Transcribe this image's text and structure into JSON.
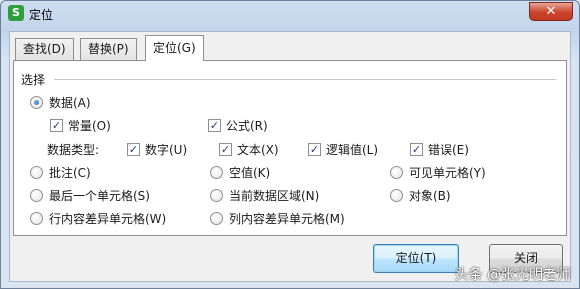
{
  "window": {
    "app_icon": "S",
    "title": "定位",
    "close_glyph": "✕"
  },
  "tabs": [
    {
      "label": "查找(D)"
    },
    {
      "label": "替换(P)"
    },
    {
      "label": "定位(G)"
    }
  ],
  "group": {
    "label": "选择"
  },
  "options": {
    "data": "数据(A)",
    "constants": "常量(O)",
    "formulas": "公式(R)",
    "data_type_label": "数据类型:",
    "number": "数字(U)",
    "text": "文本(X)",
    "logical": "逻辑值(L)",
    "error": "错误(E)",
    "comments": "批注(C)",
    "blanks": "空值(K)",
    "visible_cells": "可见单元格(Y)",
    "last_cell": "最后一个单元格(S)",
    "current_region": "当前数据区域(N)",
    "objects": "对象(B)",
    "row_differences": "行内容差异单元格(W)",
    "column_differences": "列内容差异单元格(M)"
  },
  "buttons": {
    "locate": "定位(T)",
    "close": "关闭"
  },
  "watermark": "头条 @张光明老师"
}
